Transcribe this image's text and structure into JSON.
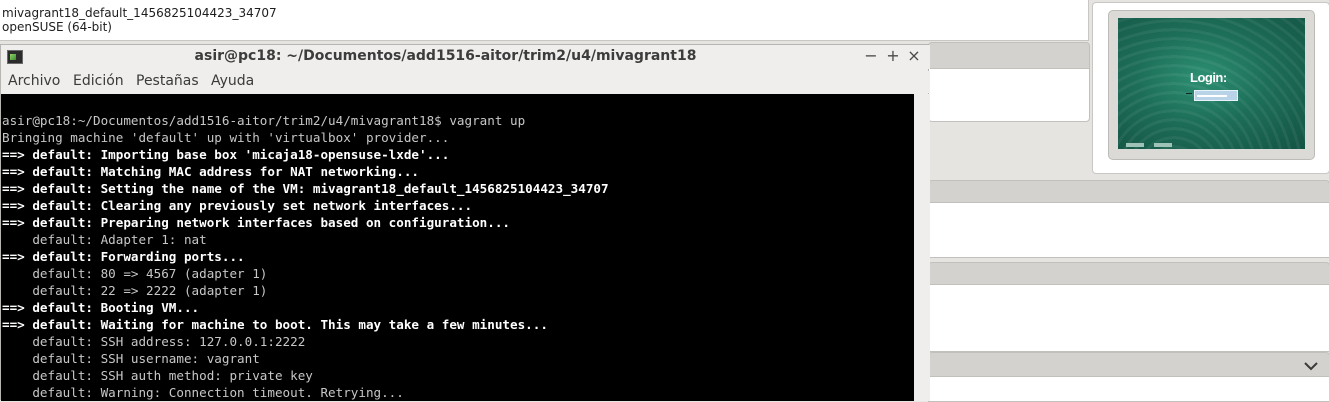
{
  "virtualbox": {
    "vm_name": "mivagrant18_default_1456825104423_34707",
    "vm_os": "openSUSE (64-bit)",
    "preview": {
      "login_label": "Login:"
    }
  },
  "terminal": {
    "title": "asir@pc18: ~/Documentos/add1516-aitor/trim2/u4/mivagrant18",
    "window_buttons": {
      "minimize": "−",
      "maximize": "+",
      "close": "×"
    },
    "menu": [
      "Archivo",
      "Edición",
      "Pestañas",
      "Ayuda"
    ],
    "lines": [
      {
        "text": "asir@pc18:~/Documentos/add1516-aitor/trim2/u4/mivagrant18$ vagrant up",
        "bold": false
      },
      {
        "text": "Bringing machine 'default' up with 'virtualbox' provider...",
        "bold": false
      },
      {
        "text": "==> default: Importing base box 'micaja18-opensuse-lxde'...",
        "bold": true
      },
      {
        "text": "==> default: Matching MAC address for NAT networking...",
        "bold": true
      },
      {
        "text": "==> default: Setting the name of the VM: mivagrant18_default_1456825104423_34707",
        "bold": true
      },
      {
        "text": "==> default: Clearing any previously set network interfaces...",
        "bold": true
      },
      {
        "text": "==> default: Preparing network interfaces based on configuration...",
        "bold": true
      },
      {
        "text": "    default: Adapter 1: nat",
        "bold": false
      },
      {
        "text": "==> default: Forwarding ports...",
        "bold": true
      },
      {
        "text": "    default: 80 => 4567 (adapter 1)",
        "bold": false
      },
      {
        "text": "    default: 22 => 2222 (adapter 1)",
        "bold": false
      },
      {
        "text": "==> default: Booting VM...",
        "bold": true
      },
      {
        "text": "==> default: Waiting for machine to boot. This may take a few minutes...",
        "bold": true
      },
      {
        "text": "    default: SSH address: 127.0.0.1:2222",
        "bold": false
      },
      {
        "text": "    default: SSH username: vagrant",
        "bold": false
      },
      {
        "text": "    default: SSH auth method: private key",
        "bold": false
      },
      {
        "text": "    default: Warning: Connection timeout. Retrying...",
        "bold": false
      }
    ]
  },
  "icons": {
    "terminal_app": "terminal-icon",
    "dropdown": "chevron-down-icon"
  }
}
